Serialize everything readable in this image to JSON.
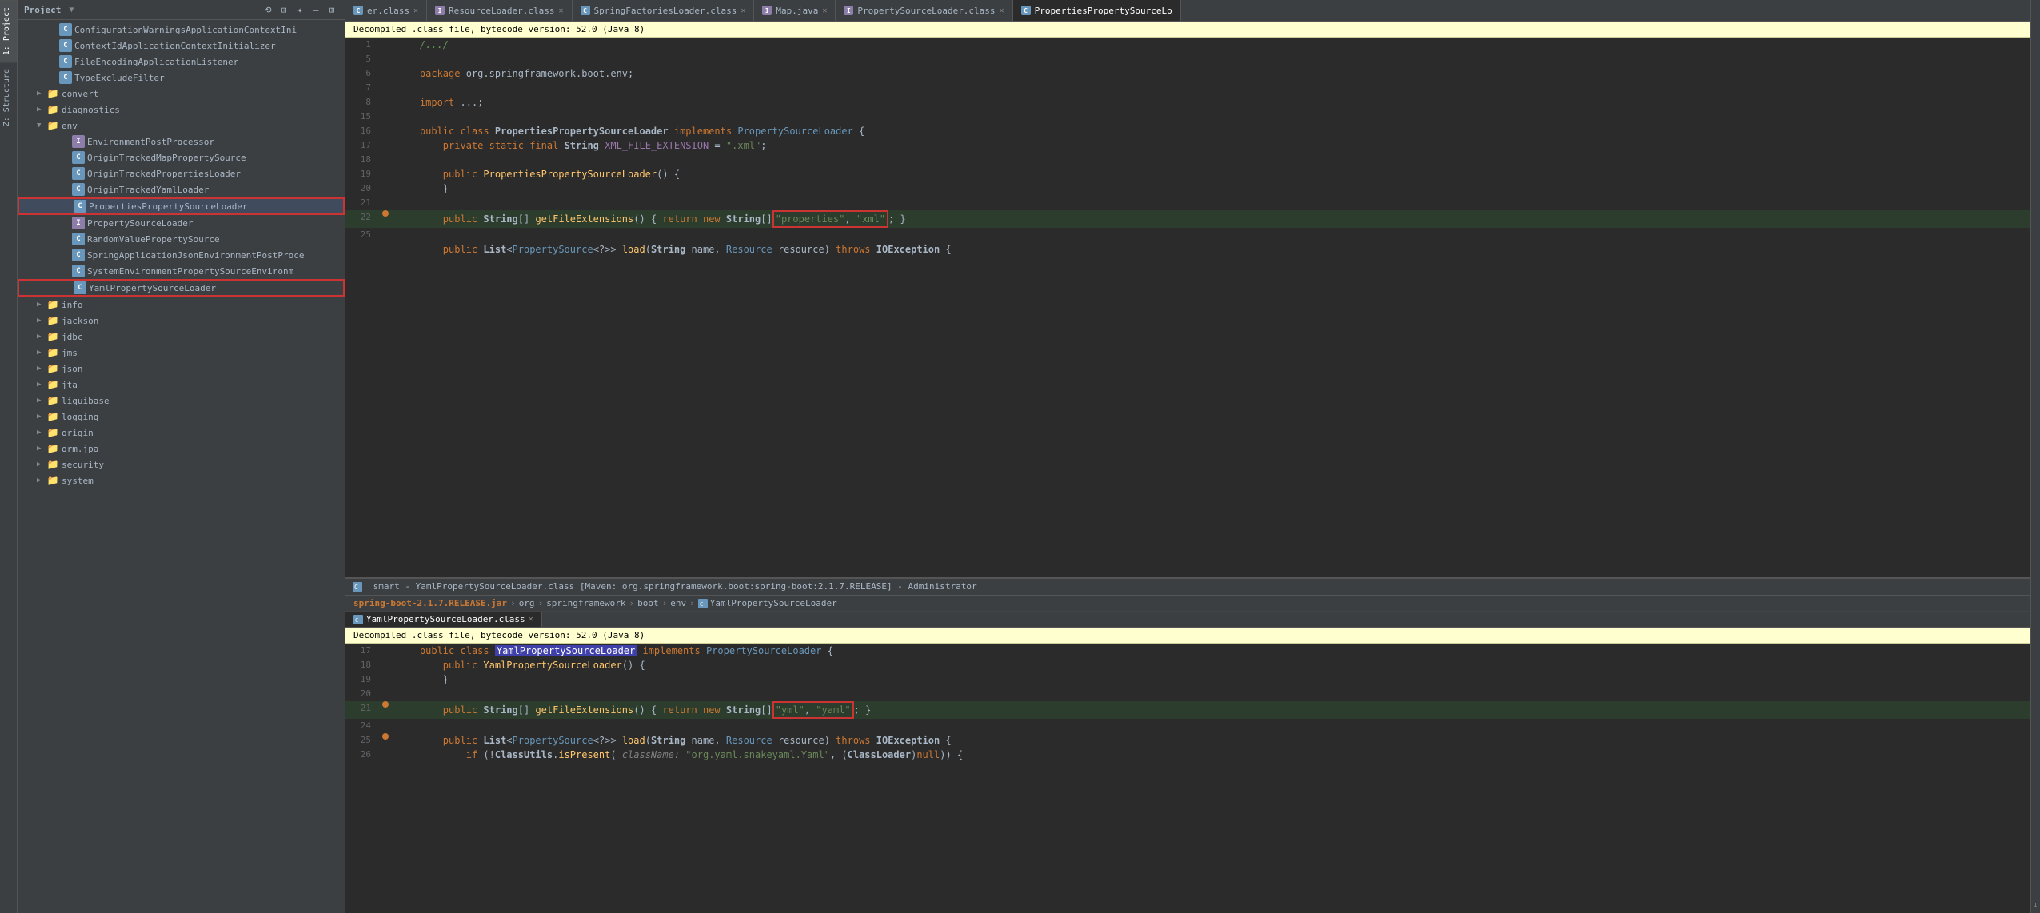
{
  "app": {
    "title": "smart - YamlPropertySourceLoader.class [Maven: org.springframework.boot:spring-boot:2.1.7.RELEASE] - Administrator"
  },
  "left_tabs": [
    {
      "id": "project",
      "label": "1: Project",
      "active": true
    },
    {
      "id": "structure",
      "label": "Z: Structure",
      "active": false
    }
  ],
  "project_panel": {
    "title": "Project",
    "toolbar_icons": [
      "⟲",
      "⊡",
      "✦",
      "—",
      "⊞"
    ]
  },
  "tree": {
    "items": [
      {
        "id": "config-warnings",
        "indent": 2,
        "type": "class",
        "label": "ConfigurationWarningsApplicationContextIni",
        "has_arrow": false,
        "selected": false,
        "boxed": false
      },
      {
        "id": "context-id",
        "indent": 2,
        "type": "class",
        "label": "ContextIdApplicationContextInitializer",
        "has_arrow": false,
        "selected": false,
        "boxed": false
      },
      {
        "id": "file-encoding",
        "indent": 2,
        "type": "class",
        "label": "FileEncodingApplicationListener",
        "has_arrow": false,
        "selected": false,
        "boxed": false
      },
      {
        "id": "type-exclude",
        "indent": 2,
        "type": "class",
        "label": "TypeExcludeFilter",
        "has_arrow": false,
        "selected": false,
        "boxed": false
      },
      {
        "id": "convert",
        "indent": 1,
        "type": "folder",
        "label": "convert",
        "has_arrow": true,
        "arrow": "▶",
        "selected": false,
        "boxed": false
      },
      {
        "id": "diagnostics",
        "indent": 1,
        "type": "folder",
        "label": "diagnostics",
        "has_arrow": true,
        "arrow": "▶",
        "selected": false,
        "boxed": false
      },
      {
        "id": "env",
        "indent": 1,
        "type": "folder",
        "label": "env",
        "has_arrow": true,
        "arrow": "▼",
        "selected": false,
        "boxed": false,
        "expanded": true
      },
      {
        "id": "env-post-processor",
        "indent": 3,
        "type": "interface",
        "label": "EnvironmentPostProcessor",
        "has_arrow": false,
        "selected": false,
        "boxed": false
      },
      {
        "id": "origin-tracked-map",
        "indent": 3,
        "type": "class",
        "label": "OriginTrackedMapPropertySource",
        "has_arrow": false,
        "selected": false,
        "boxed": false
      },
      {
        "id": "origin-tracked-props",
        "indent": 3,
        "type": "class",
        "label": "OriginTrackedPropertiesLoader",
        "has_arrow": false,
        "selected": false,
        "boxed": false
      },
      {
        "id": "origin-tracked-yaml",
        "indent": 3,
        "type": "class",
        "label": "OriginTrackedYamlLoader",
        "has_arrow": false,
        "selected": false,
        "boxed": false
      },
      {
        "id": "properties-loader",
        "indent": 3,
        "type": "class",
        "label": "PropertiesPropertySourceLoader",
        "has_arrow": false,
        "selected": true,
        "boxed": true
      },
      {
        "id": "property-source-loader",
        "indent": 3,
        "type": "interface",
        "label": "PropertySourceLoader",
        "has_arrow": false,
        "selected": false,
        "boxed": false
      },
      {
        "id": "random-value",
        "indent": 3,
        "type": "class",
        "label": "RandomValuePropertySource",
        "has_arrow": false,
        "selected": false,
        "boxed": false
      },
      {
        "id": "spring-app-json",
        "indent": 3,
        "type": "class",
        "label": "SpringApplicationJsonEnvironmentPostProce",
        "has_arrow": false,
        "selected": false,
        "boxed": false
      },
      {
        "id": "system-env",
        "indent": 3,
        "type": "class",
        "label": "SystemEnvironmentPropertySourceEnvironm",
        "has_arrow": false,
        "selected": false,
        "boxed": false
      },
      {
        "id": "yaml-loader",
        "indent": 3,
        "type": "class",
        "label": "YamlPropertySourceLoader",
        "has_arrow": false,
        "selected": false,
        "boxed": true
      },
      {
        "id": "info",
        "indent": 1,
        "type": "folder",
        "label": "info",
        "has_arrow": true,
        "arrow": "▶",
        "selected": false,
        "boxed": false
      },
      {
        "id": "jackson",
        "indent": 1,
        "type": "folder",
        "label": "jackson",
        "has_arrow": true,
        "arrow": "▶",
        "selected": false,
        "boxed": false
      },
      {
        "id": "jdbc",
        "indent": 1,
        "type": "folder",
        "label": "jdbc",
        "has_arrow": true,
        "arrow": "▶",
        "selected": false,
        "boxed": false
      },
      {
        "id": "jms",
        "indent": 1,
        "type": "folder",
        "label": "jms",
        "has_arrow": true,
        "arrow": "▶",
        "selected": false,
        "boxed": false
      },
      {
        "id": "json",
        "indent": 1,
        "type": "folder",
        "label": "json",
        "has_arrow": true,
        "arrow": "▶",
        "selected": false,
        "boxed": false
      },
      {
        "id": "jta",
        "indent": 1,
        "type": "folder",
        "label": "jta",
        "has_arrow": true,
        "arrow": "▶",
        "selected": false,
        "boxed": false
      },
      {
        "id": "liquibase",
        "indent": 1,
        "type": "folder",
        "label": "liquibase",
        "has_arrow": true,
        "arrow": "▶",
        "selected": false,
        "boxed": false
      },
      {
        "id": "logging",
        "indent": 1,
        "type": "folder",
        "label": "logging",
        "has_arrow": true,
        "arrow": "▶",
        "selected": false,
        "boxed": false
      },
      {
        "id": "origin",
        "indent": 1,
        "type": "folder",
        "label": "origin",
        "has_arrow": true,
        "arrow": "▶",
        "selected": false,
        "boxed": false
      },
      {
        "id": "orm-jpa",
        "indent": 1,
        "type": "folder",
        "label": "orm.jpa",
        "has_arrow": true,
        "arrow": "▶",
        "selected": false,
        "boxed": false
      },
      {
        "id": "security",
        "indent": 1,
        "type": "folder",
        "label": "security",
        "has_arrow": true,
        "arrow": "▶",
        "selected": false,
        "boxed": false
      },
      {
        "id": "system",
        "indent": 1,
        "type": "folder",
        "label": "system",
        "has_arrow": true,
        "arrow": "▶",
        "selected": false,
        "boxed": false
      }
    ]
  },
  "top_tabs": [
    {
      "id": "er-class",
      "icon": "c",
      "label": "er.class",
      "active": false,
      "closable": true
    },
    {
      "id": "resource-loader",
      "icon": "i",
      "label": "ResourceLoader.class",
      "active": false,
      "closable": true
    },
    {
      "id": "spring-factories",
      "icon": "c",
      "label": "SpringFactoriesLoader.class",
      "active": false,
      "closable": true
    },
    {
      "id": "map-java",
      "icon": "i",
      "label": "Map.java",
      "active": false,
      "closable": true
    },
    {
      "id": "property-source-loader-class",
      "icon": "i",
      "label": "PropertySourceLoader.class",
      "active": false,
      "closable": true
    },
    {
      "id": "properties-property-source-loader",
      "icon": "c",
      "label": "PropertiesPropertySourceLo",
      "active": true,
      "closable": false
    }
  ],
  "top_editor": {
    "info_bar": "Decompiled .class file, bytecode version: 52.0 (Java 8)",
    "lines": [
      {
        "num": 1,
        "gutter": "",
        "code": "    /.../"
      },
      {
        "num": 5,
        "gutter": "",
        "code": ""
      },
      {
        "num": 6,
        "gutter": "",
        "code": "    package org.springframework.boot.env;"
      },
      {
        "num": 7,
        "gutter": "",
        "code": ""
      },
      {
        "num": 8,
        "gutter": "",
        "code": "    import ...;"
      },
      {
        "num": 15,
        "gutter": "",
        "code": ""
      },
      {
        "num": 16,
        "gutter": "",
        "code": "    public class PropertiesPropertySourceLoader implements PropertySourceLoader {"
      },
      {
        "num": 17,
        "gutter": "",
        "code": "        private static final String XML_FILE_EXTENSION = \".xml\";"
      },
      {
        "num": 18,
        "gutter": "",
        "code": ""
      },
      {
        "num": 19,
        "gutter": "",
        "code": "        public PropertiesPropertySourceLoader() {"
      },
      {
        "num": 20,
        "gutter": "",
        "code": "        }"
      },
      {
        "num": 21,
        "gutter": "",
        "code": ""
      },
      {
        "num": 22,
        "gutter": "dot",
        "code": "        public String[] getFileExtensions() { return new String[]{\"properties\", \"xml\"}; }"
      },
      {
        "num": 25,
        "gutter": "",
        "code": ""
      },
      {
        "num": "...",
        "gutter": "",
        "code": "        public List<PropertySource<?>> load(String name, Resource resource) throws IOException {"
      }
    ]
  },
  "popup_window": {
    "title_bar": "smart - YamlPropertySourceLoader.class [Maven: org.springframework.boot:spring-boot:2.1.7.RELEASE] - Administrator",
    "breadcrumb": {
      "jar": "spring-boot-2.1.7.RELEASE.jar",
      "org": "org",
      "springframework": "springframework",
      "boot": "boot",
      "env": "env",
      "icon": "c",
      "class": "YamlPropertySourceLoader"
    },
    "tab": "YamlPropertySourceLoader.class",
    "info_bar": "Decompiled .class file, bytecode version: 52.0 (Java 8)",
    "lines": [
      {
        "num": 17,
        "gutter": "",
        "code": "    public class YamlPropertySourceLoader implements PropertySourceLoader {"
      },
      {
        "num": 18,
        "gutter": "",
        "code": "        public YamlPropertySourceLoader() {"
      },
      {
        "num": 19,
        "gutter": "",
        "code": "        }"
      },
      {
        "num": 20,
        "gutter": "",
        "code": ""
      },
      {
        "num": 21,
        "gutter": "dot",
        "code": "        public String[] getFileExtensions() { return new String[]{\"yml\", \"yaml\"}; }"
      },
      {
        "num": 24,
        "gutter": "",
        "code": ""
      },
      {
        "num": 25,
        "gutter": "dot",
        "code": "        public List<PropertySource<?>> load(String name, Resource resource) throws IOException {"
      },
      {
        "num": 26,
        "gutter": "",
        "code": "            if (!ClassUtils.isPresent( className: \"org.yaml.snakeyaml.Yaml\", (ClassLoader)null)) {"
      }
    ]
  },
  "colors": {
    "keyword": "#cc7832",
    "string": "#6a8759",
    "class_name": "#a9b7c6",
    "interface": "#6897bb",
    "method": "#ffc66d",
    "comment": "#629755",
    "annotation": "#808080",
    "number": "#6897bb",
    "purple": "#9876aa",
    "highlight_border": "#cc3333",
    "info_bar_bg": "#ffffd0",
    "selected_bg": "#4b6eaf55"
  }
}
